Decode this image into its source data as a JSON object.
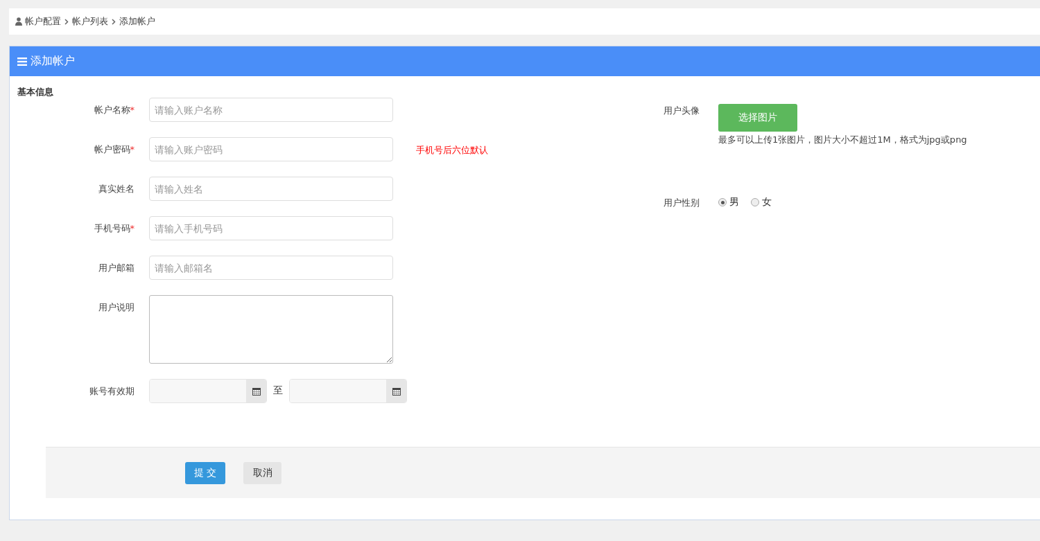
{
  "breadcrumb": [
    {
      "label": "帐户配置"
    },
    {
      "label": "帐户列表"
    },
    {
      "label": "添加帐户"
    }
  ],
  "panel": {
    "title": "添加帐户"
  },
  "section_title": "基本信息",
  "fields": [
    {
      "kind": "input",
      "label": "帐户名称",
      "required_mark": "*",
      "placeholder": "请输入账户名称"
    },
    {
      "kind": "input",
      "label": "帐户密码",
      "required_mark": "*",
      "placeholder": "请输入账户密码",
      "note": "手机号后六位默认"
    },
    {
      "kind": "input",
      "label": "真实姓名",
      "placeholder": "请输入姓名"
    },
    {
      "kind": "input",
      "label": "手机号码",
      "required_mark": "*",
      "placeholder": "请输入手机号码"
    },
    {
      "kind": "input",
      "label": "用户邮箱",
      "placeholder": "请输入邮箱名"
    },
    {
      "kind": "textarea",
      "label": "用户说明"
    },
    {
      "kind": "daterange",
      "label": "账号有效期",
      "separator": "至"
    }
  ],
  "avatar": {
    "label": "用户头像",
    "button": "选择图片",
    "hint": "最多可以上传1张图片，图片大小不超过1M，格式为jpg或png"
  },
  "gender": {
    "label": "用户性别",
    "options": [
      {
        "label": "男",
        "selected": true
      },
      {
        "label": "女",
        "selected": false
      }
    ]
  },
  "actions": [
    {
      "kind": "primary",
      "label": "提 交"
    },
    {
      "kind": "default",
      "label": "取消"
    }
  ]
}
